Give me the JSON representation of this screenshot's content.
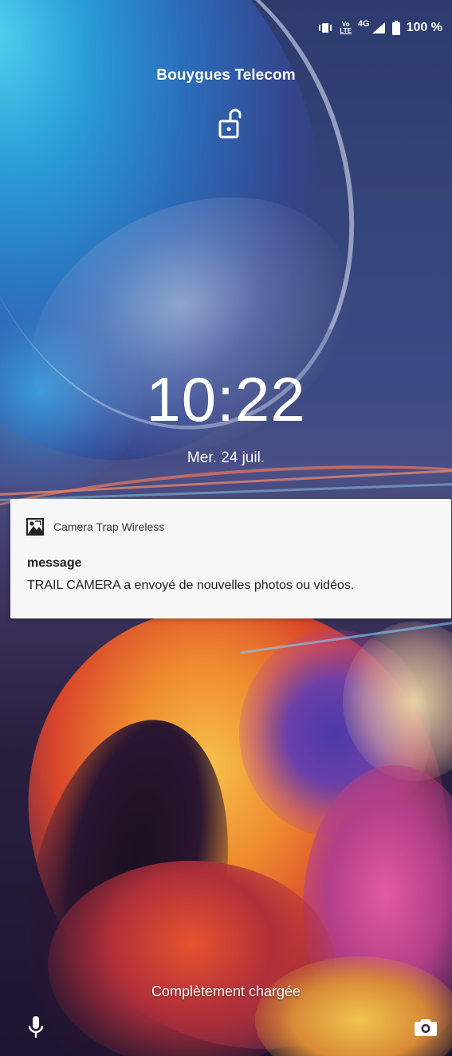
{
  "status_bar": {
    "volte_line1": "Vo",
    "volte_line2": "LTE",
    "network": "4G",
    "battery_percent": "100 %",
    "icons": [
      "vibrate-icon",
      "volte-icon",
      "signal-icon",
      "battery-icon"
    ]
  },
  "lockscreen": {
    "carrier": "Bouygues Telecom",
    "lock_state_icon": "unlocked-padlock-icon",
    "time": "10:22",
    "date": "Mer. 24 juil.",
    "charging_status": "Complètement chargée"
  },
  "notification": {
    "app_name": "Camera Trap Wireless",
    "app_icon": "camera-trap-app-icon",
    "title": "message",
    "text": "TRAIL CAMERA a envoyé de nouvelles photos ou vidéos.",
    "background": "#f7f7f7"
  },
  "shortcuts": {
    "left_icon": "microphone-icon",
    "right_icon": "camera-icon"
  }
}
